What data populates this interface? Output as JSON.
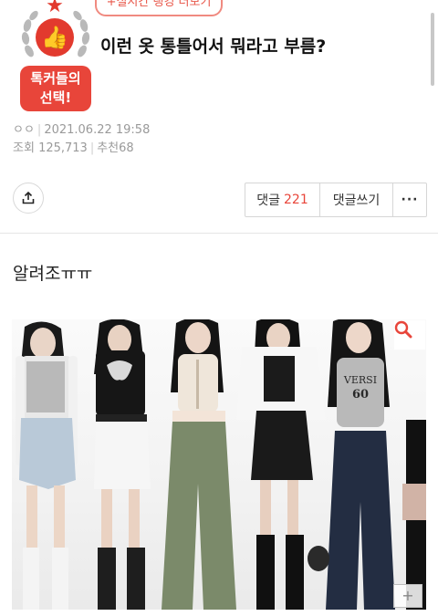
{
  "header": {
    "ranking_link": "+실시간 랭킹 더보기",
    "badge_line1": "톡커들의",
    "badge_line2": "선택!",
    "title": "이런 옷 통틀어서 뭐라고 부름?"
  },
  "post_meta": {
    "author": "ㅇㅇ",
    "date": "2021.06.22 19:58",
    "views_label": "조회",
    "views": "125,713",
    "recommend_label": "추천",
    "recommend": "68"
  },
  "actions": {
    "comments_label": "댓글",
    "comments_count": "221",
    "write_comment_label": "댓글쓰기",
    "more_label": "···"
  },
  "post_body": {
    "text": "알려조ㅠㅠ"
  },
  "photo_print": {
    "top_text": "VERSI",
    "number": "60"
  },
  "icons": {
    "share": "share-icon",
    "zoom": "magnifier-icon",
    "expand": "plus-icon"
  },
  "colors": {
    "accent": "#e8453a",
    "meta_gray": "#9a9a9a"
  }
}
